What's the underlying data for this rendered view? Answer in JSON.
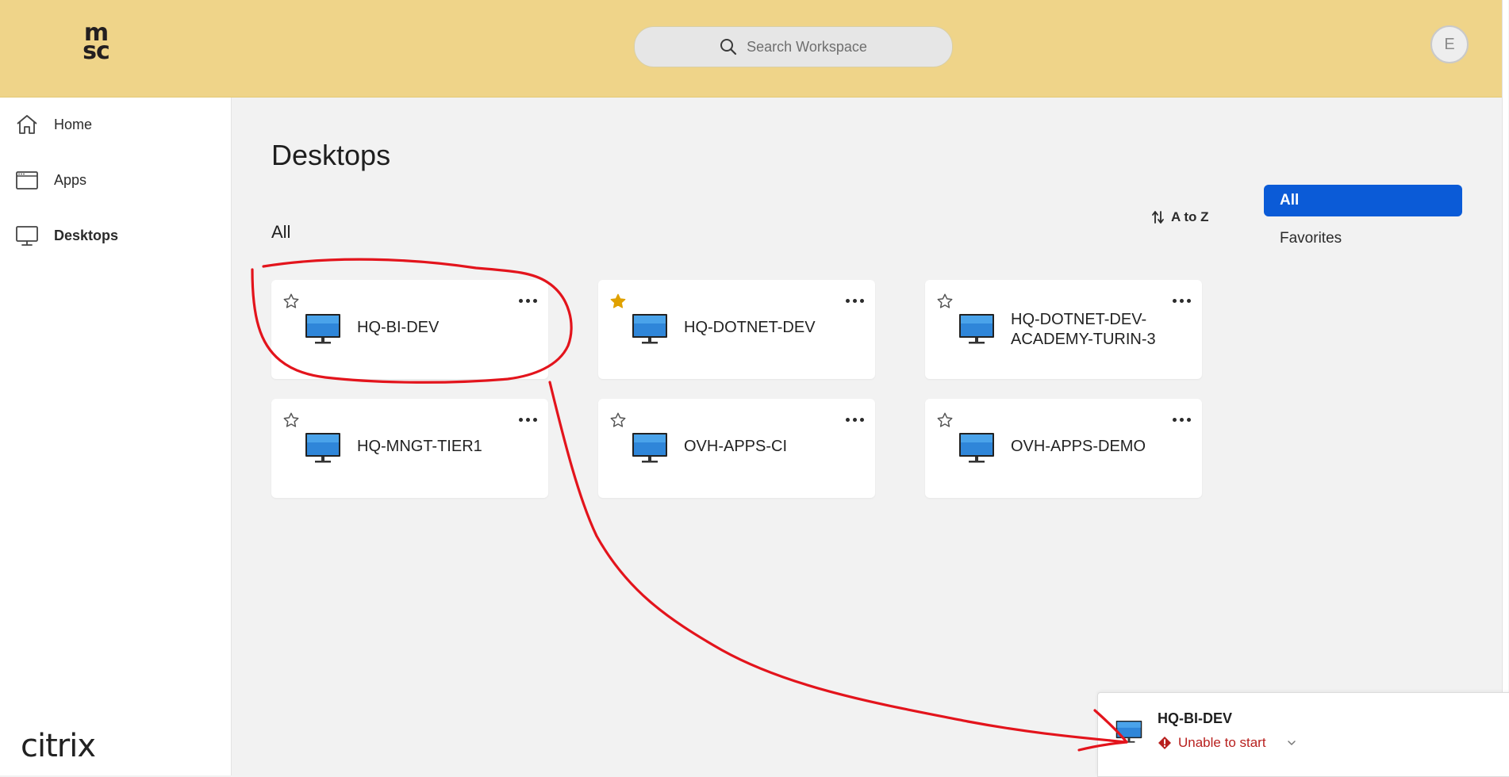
{
  "header": {
    "logo_top": "m",
    "logo_bottom": "sc",
    "search_placeholder": "Search Workspace",
    "avatar_initial": "E",
    "background_color": "#efd489"
  },
  "sidebar": {
    "items": [
      {
        "label": "Home",
        "icon": "home-icon",
        "active": false
      },
      {
        "label": "Apps",
        "icon": "apps-window-icon",
        "active": false
      },
      {
        "label": "Desktops",
        "icon": "desktop-monitor-icon",
        "active": true
      }
    ],
    "brand": "citrix"
  },
  "main": {
    "title": "Desktops",
    "section_label": "All",
    "sort_label": "A to Z",
    "filters": [
      {
        "label": "All",
        "selected": true
      },
      {
        "label": "Favorites",
        "selected": false
      }
    ],
    "accent_color": "#0b5bd7",
    "desktops": [
      {
        "name": "HQ-BI-DEV",
        "favorite": false
      },
      {
        "name": "HQ-DOTNET-DEV",
        "favorite": true
      },
      {
        "name": "HQ-DOTNET-DEV-ACADEMY-TURIN-3",
        "name_line1": "HQ-DOTNET-DEV-",
        "name_line2": "ACADEMY-TURIN-3",
        "favorite": false
      },
      {
        "name": "HQ-MNGT-TIER1",
        "favorite": false
      },
      {
        "name": "OVH-APPS-CI",
        "favorite": false
      },
      {
        "name": "OVH-APPS-DEMO",
        "favorite": false
      }
    ]
  },
  "notification": {
    "name": "HQ-BI-DEV",
    "status": "Unable to start",
    "status_color": "#b8201e"
  },
  "annotation": {
    "color": "#e3141c"
  }
}
